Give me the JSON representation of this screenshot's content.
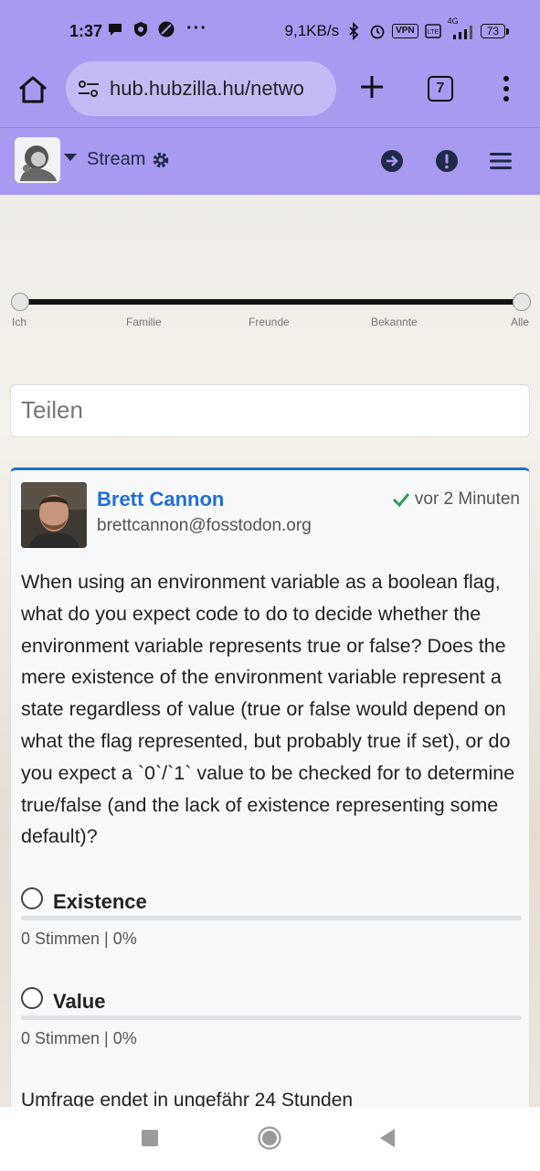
{
  "status_bar": {
    "time": "1:37",
    "dots": "···",
    "network_speed": "9,1KB/s",
    "vpn": "VPN",
    "lte": "4G",
    "battery": "73"
  },
  "browser": {
    "url": "hub.hubzilla.hu/netwo",
    "tab_count": "7"
  },
  "app_nav": {
    "title": "Stream"
  },
  "slider": {
    "labels": [
      "Ich",
      "Familie",
      "Freunde",
      "Bekannte",
      "Alle"
    ]
  },
  "share": {
    "placeholder": "Teilen"
  },
  "post": {
    "author": "Brett Cannon",
    "handle": "brettcannon@fosstodon.org",
    "time": "vor 2 Minuten",
    "body": "When using an environment variable as a boolean flag, what do you expect code to do to decide whether the environment variable represents true or false? Does the mere existence of the environment variable represent a state regardless of value (true or false would depend on what the flag represented, but probably true if set), or do you expect a `0`/`1` value to be checked for to determine true/false (and the lack of existence representing some default)?",
    "poll": {
      "options": [
        {
          "label": "Existence",
          "votes": "0 Stimmen | 0%"
        },
        {
          "label": "Value",
          "votes": "0 Stimmen | 0%"
        }
      ],
      "ends": "Umfrage endet in ungefähr 24 Stunden"
    }
  },
  "colors": {
    "accent": "#a79af0",
    "link": "#1e6fd9",
    "check": "#2e9e5b"
  }
}
